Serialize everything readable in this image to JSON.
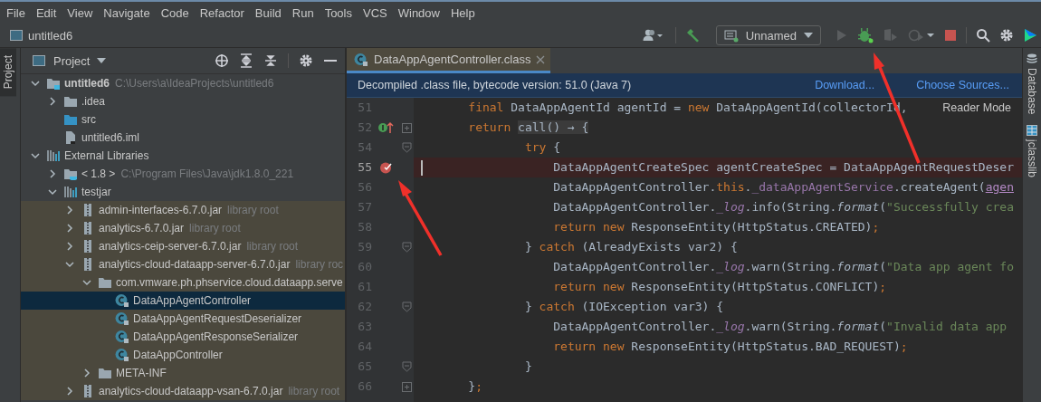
{
  "menu": [
    "File",
    "Edit",
    "View",
    "Navigate",
    "Code",
    "Refactor",
    "Build",
    "Run",
    "Tools",
    "VCS",
    "Window",
    "Help"
  ],
  "breadcrumb": "untitled6",
  "toolbar": [
    {
      "kind": "user"
    },
    {
      "kind": "build"
    },
    {
      "kind": "config",
      "label": "Unnamed"
    },
    {
      "kind": "run",
      "disabled": true
    },
    {
      "kind": "debug",
      "disabled": false
    },
    {
      "kind": "coverage",
      "disabled": true
    },
    {
      "kind": "profile",
      "disabled": true
    },
    {
      "kind": "stop",
      "disabled": false
    },
    {
      "kind": "search"
    },
    {
      "kind": "settings"
    },
    {
      "kind": "logo"
    }
  ],
  "left_strip": [
    {
      "label": "Project",
      "selected": true
    }
  ],
  "project_panel": {
    "title": "Project",
    "tree": [
      {
        "label": "untitled6",
        "hint": "C:\\Users\\a\\IdeaProjects\\untitled6",
        "kind": "project",
        "expanded": true,
        "selected": false,
        "children": [
          {
            "label": ".idea",
            "kind": "folder",
            "expanded": false,
            "selected": false
          },
          {
            "label": "src",
            "kind": "source-folder",
            "selected": false
          },
          {
            "label": "untitled6.iml",
            "kind": "file",
            "selected": false
          }
        ]
      },
      {
        "label": "External Libraries",
        "kind": "libraries",
        "expanded": true,
        "selected": false,
        "children": [
          {
            "label": "< 1.8 >",
            "hint": "C:\\Program Files\\Java\\jdk1.8.0_221",
            "kind": "jdk",
            "expanded": false,
            "selected": false
          },
          {
            "label": "testjar",
            "kind": "library",
            "expanded": true,
            "selected": false,
            "children": [
              {
                "label": "admin-interfaces-6.7.0.jar",
                "hint": "library root",
                "kind": "jar",
                "expanded": false,
                "selected": false
              },
              {
                "label": "analytics-6.7.0.jar",
                "hint": "library root",
                "kind": "jar",
                "expanded": false,
                "selected": false
              },
              {
                "label": "analytics-ceip-server-6.7.0.jar",
                "hint": "library root",
                "kind": "jar",
                "expanded": false,
                "selected": false
              },
              {
                "label": "analytics-cloud-dataapp-server-6.7.0.jar",
                "hint": "library roc",
                "kind": "jar",
                "expanded": true,
                "selected": false,
                "children": [
                  {
                    "label": "com.vmware.ph.phservice.cloud.dataapp.serve",
                    "kind": "package",
                    "expanded": true,
                    "selected": false,
                    "children": [
                      {
                        "label": "DataAppAgentController",
                        "kind": "class",
                        "selected": true
                      },
                      {
                        "label": "DataAppAgentRequestDeserializer",
                        "kind": "class",
                        "selected": false
                      },
                      {
                        "label": "DataAppAgentResponseSerializer",
                        "kind": "class",
                        "selected": false
                      },
                      {
                        "label": "DataAppController",
                        "kind": "class",
                        "selected": false
                      }
                    ]
                  },
                  {
                    "label": "META-INF",
                    "kind": "package",
                    "expanded": false,
                    "selected": false
                  }
                ]
              },
              {
                "label": "analytics-cloud-dataapp-vsan-6.7.0.jar",
                "hint": "library root",
                "kind": "jar",
                "expanded": false,
                "selected": false
              }
            ]
          }
        ]
      }
    ]
  },
  "editor": {
    "tab": {
      "label": "DataAppAgentController.class",
      "selected": true
    },
    "banner": {
      "text": "Decompiled .class file, bytecode version: 51.0 (Java 7)",
      "links": [
        "Download...",
        "Choose Sources..."
      ]
    },
    "reader_mode": "Reader Mode",
    "lines": [
      {
        "number": "51",
        "breakpoint": false,
        "caret": false,
        "tokens": [
          {
            "kind": "kw",
            "text": "    final "
          },
          {
            "kind": "plain",
            "text": "DataAppAgentId agentId = "
          },
          {
            "kind": "kw",
            "text": "new "
          },
          {
            "kind": "plain",
            "text": "DataAppAgentId(collectorId,"
          }
        ]
      },
      {
        "number": "52",
        "breakpoint": false,
        "caret": false,
        "gutter": {
          "kind": "implements"
        },
        "fold": {
          "kind": "collapsed"
        },
        "tokens": [
          {
            "kind": "kw",
            "text": "    return "
          },
          {
            "kind": "fold",
            "text": "call() → {"
          }
        ]
      },
      {
        "number": "54",
        "breakpoint": false,
        "caret": false,
        "fold": {
          "kind": "expanded"
        },
        "tokens": [
          {
            "kind": "kw",
            "text": "            try "
          },
          {
            "kind": "plain",
            "text": "{"
          }
        ]
      },
      {
        "number": "55",
        "breakpoint": true,
        "caret": true,
        "tokens": [
          {
            "kind": "plain",
            "text": "                DataAppAgentCreateSpec agentCreateSpec = DataAppAgentRequestDeser"
          }
        ]
      },
      {
        "number": "56",
        "breakpoint": false,
        "caret": false,
        "tokens": [
          {
            "kind": "plain",
            "text": "                DataAppAgentController."
          },
          {
            "kind": "kw",
            "text": "this"
          },
          {
            "kind": "plain",
            "text": "."
          },
          {
            "kind": "field",
            "text": "_dataAppAgentService"
          },
          {
            "kind": "plain",
            "text": ".createAgent("
          },
          {
            "kind": "param",
            "text": "agen"
          }
        ]
      },
      {
        "number": "57",
        "breakpoint": false,
        "caret": false,
        "tokens": [
          {
            "kind": "plain",
            "text": "                DataAppAgentController."
          },
          {
            "kind": "static",
            "text": "_log"
          },
          {
            "kind": "plain",
            "text": ".info(String."
          },
          {
            "kind": "method",
            "text": "format"
          },
          {
            "kind": "plain",
            "text": "("
          },
          {
            "kind": "str",
            "text": "\"Successfully crea"
          }
        ]
      },
      {
        "number": "58",
        "breakpoint": false,
        "caret": false,
        "tokens": [
          {
            "kind": "kw",
            "text": "                return new "
          },
          {
            "kind": "plain",
            "text": "ResponseEntity(HttpStatus.CREATED)"
          },
          {
            "kind": "kw",
            "text": ";"
          }
        ]
      },
      {
        "number": "59",
        "breakpoint": false,
        "caret": false,
        "fold": {
          "kind": "expanded"
        },
        "tokens": [
          {
            "kind": "plain",
            "text": "            } "
          },
          {
            "kind": "kw",
            "text": "catch "
          },
          {
            "kind": "plain",
            "text": "(AlreadyExists var2) {"
          }
        ]
      },
      {
        "number": "60",
        "breakpoint": false,
        "caret": false,
        "tokens": [
          {
            "kind": "plain",
            "text": "                DataAppAgentController."
          },
          {
            "kind": "static",
            "text": "_log"
          },
          {
            "kind": "plain",
            "text": ".warn(String."
          },
          {
            "kind": "method",
            "text": "format"
          },
          {
            "kind": "plain",
            "text": "("
          },
          {
            "kind": "str",
            "text": "\"Data app agent fo"
          }
        ]
      },
      {
        "number": "61",
        "breakpoint": false,
        "caret": false,
        "tokens": [
          {
            "kind": "kw",
            "text": "                return new "
          },
          {
            "kind": "plain",
            "text": "ResponseEntity(HttpStatus.CONFLICT)"
          },
          {
            "kind": "kw",
            "text": ";"
          }
        ]
      },
      {
        "number": "62",
        "breakpoint": false,
        "caret": false,
        "fold": {
          "kind": "expanded"
        },
        "tokens": [
          {
            "kind": "plain",
            "text": "            } "
          },
          {
            "kind": "kw",
            "text": "catch "
          },
          {
            "kind": "plain",
            "text": "(IOException var3) {"
          }
        ]
      },
      {
        "number": "63",
        "breakpoint": false,
        "caret": false,
        "tokens": [
          {
            "kind": "plain",
            "text": "                DataAppAgentController."
          },
          {
            "kind": "static",
            "text": "_log"
          },
          {
            "kind": "plain",
            "text": ".warn(String."
          },
          {
            "kind": "method",
            "text": "format"
          },
          {
            "kind": "plain",
            "text": "("
          },
          {
            "kind": "str",
            "text": "\"Invalid data app"
          }
        ]
      },
      {
        "number": "64",
        "breakpoint": false,
        "caret": false,
        "tokens": [
          {
            "kind": "kw",
            "text": "                return new "
          },
          {
            "kind": "plain",
            "text": "ResponseEntity(HttpStatus.BAD_REQUEST)"
          },
          {
            "kind": "kw",
            "text": ";"
          }
        ]
      },
      {
        "number": "65",
        "breakpoint": false,
        "caret": false,
        "fold": {
          "kind": "expanded"
        },
        "tokens": [
          {
            "kind": "plain",
            "text": "            }"
          }
        ]
      },
      {
        "number": "66",
        "breakpoint": false,
        "caret": false,
        "fold": {
          "kind": "collapsed"
        },
        "tokens": [
          {
            "kind": "plain",
            "text": "    }"
          },
          {
            "kind": "kw",
            "text": ";"
          }
        ]
      }
    ]
  },
  "right_strip": [
    {
      "label": "Database",
      "kind": "database"
    },
    {
      "label": "jclasslib",
      "kind": "jclasslib"
    }
  ]
}
